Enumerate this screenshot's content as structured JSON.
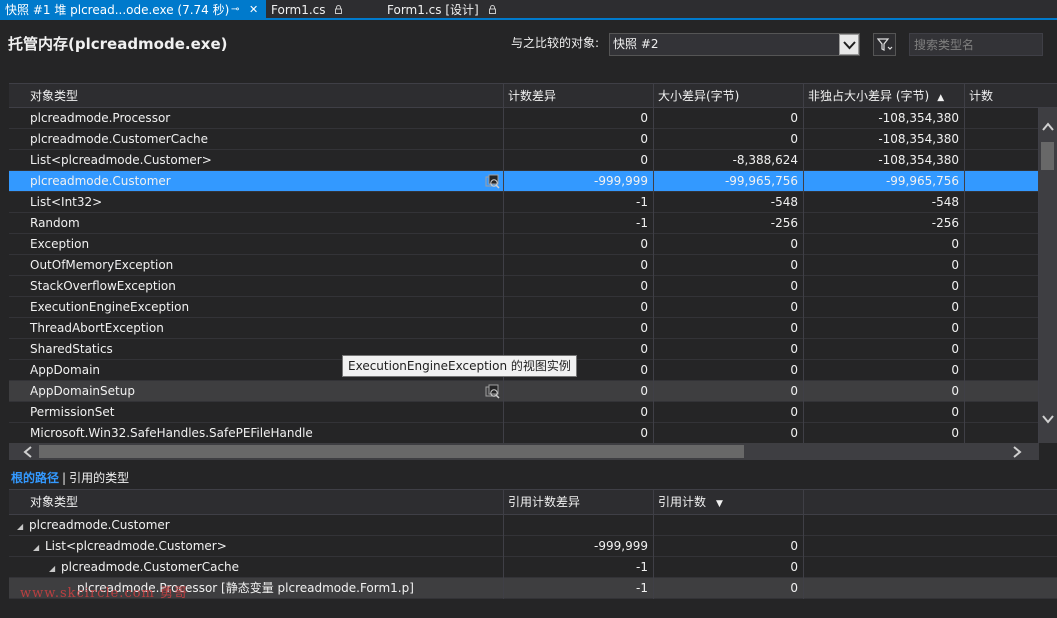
{
  "tabs": [
    {
      "label": "快照 #1 堆 plcread...ode.exe (7.74 秒)",
      "active": true,
      "pin": "⊸",
      "close": "✕"
    },
    {
      "label": "Form1.cs",
      "active": false,
      "lock": "🔒"
    },
    {
      "label": "Form1.cs [设计]",
      "active": false,
      "lock": "🔒"
    }
  ],
  "header": {
    "title": "托管内存(plcreadmode.exe)",
    "compare_label": "与之比较的对象:",
    "compare_value": "快照 #2",
    "search_placeholder": "搜索类型名"
  },
  "grid": {
    "columns": [
      "对象类型",
      "计数差异",
      "大小差异(字节)",
      "非独占大小差异 (字节)",
      "计数"
    ],
    "sorted_column_index": 3,
    "sort_direction": "ascending",
    "rows": [
      {
        "name": "plcreadmode.Processor",
        "count_diff": "0",
        "size_diff": "0",
        "incl_size_diff": "-108,354,380",
        "count": ""
      },
      {
        "name": "plcreadmode.CustomerCache",
        "count_diff": "0",
        "size_diff": "0",
        "incl_size_diff": "-108,354,380",
        "count": ""
      },
      {
        "name": "List<plcreadmode.Customer>",
        "count_diff": "0",
        "size_diff": "-8,388,624",
        "incl_size_diff": "-108,354,380",
        "count": ""
      },
      {
        "name": "plcreadmode.Customer",
        "count_diff": "-999,999",
        "size_diff": "-99,965,756",
        "incl_size_diff": "-99,965,756",
        "count": "",
        "selected": true,
        "icon": "instances-icon"
      },
      {
        "name": "List<Int32>",
        "count_diff": "-1",
        "size_diff": "-548",
        "incl_size_diff": "-548",
        "count": ""
      },
      {
        "name": "Random",
        "count_diff": "-1",
        "size_diff": "-256",
        "incl_size_diff": "-256",
        "count": ""
      },
      {
        "name": "Exception",
        "count_diff": "0",
        "size_diff": "0",
        "incl_size_diff": "0",
        "count": ""
      },
      {
        "name": "OutOfMemoryException",
        "count_diff": "0",
        "size_diff": "0",
        "incl_size_diff": "0",
        "count": ""
      },
      {
        "name": "StackOverflowException",
        "count_diff": "0",
        "size_diff": "0",
        "incl_size_diff": "0",
        "count": ""
      },
      {
        "name": "ExecutionEngineException",
        "count_diff": "0",
        "size_diff": "0",
        "incl_size_diff": "0",
        "count": ""
      },
      {
        "name": "ThreadAbortException",
        "count_diff": "0",
        "size_diff": "0",
        "incl_size_diff": "0",
        "count": ""
      },
      {
        "name": "SharedStatics",
        "count_diff": "0",
        "size_diff": "0",
        "incl_size_diff": "0",
        "count": ""
      },
      {
        "name": "AppDomain",
        "count_diff": "0",
        "size_diff": "0",
        "incl_size_diff": "0",
        "count": ""
      },
      {
        "name": "AppDomainSetup",
        "count_diff": "0",
        "size_diff": "0",
        "incl_size_diff": "0",
        "count": "",
        "hover": true,
        "icon": "instances-icon"
      },
      {
        "name": "PermissionSet",
        "count_diff": "0",
        "size_diff": "0",
        "incl_size_diff": "0",
        "count": ""
      },
      {
        "name": "Microsoft.Win32.SafeHandles.SafePEFileHandle",
        "count_diff": "0",
        "size_diff": "0",
        "incl_size_diff": "0",
        "count": ""
      }
    ]
  },
  "tooltip": "ExecutionEngineException 的视图实例",
  "bottom": {
    "tab_active": "根的路径",
    "separator": "|",
    "tab_inactive": "引用的类型",
    "columns": [
      "对象类型",
      "引用计数差异",
      "引用计数"
    ],
    "sort_indicator": "▼",
    "rows": [
      {
        "indent": 0,
        "expander": "◢",
        "name": "plcreadmode.Customer",
        "ref_count_diff": "",
        "ref_count": ""
      },
      {
        "indent": 1,
        "expander": "◢",
        "name": "List<plcreadmode.Customer>",
        "ref_count_diff": "-999,999",
        "ref_count": "0"
      },
      {
        "indent": 2,
        "expander": "◢",
        "name": "plcreadmode.CustomerCache",
        "ref_count_diff": "-1",
        "ref_count": "0"
      },
      {
        "indent": 3,
        "expander": "",
        "name": "plcreadmode.Processor [静态变量 plcreadmode.Form1.p]",
        "ref_count_diff": "-1",
        "ref_count": "0",
        "hover": true
      }
    ]
  },
  "watermark": "www.skcircle.com 勇哥",
  "colors": {
    "accent": "#007acc",
    "selection": "#3399ff",
    "background": "#252526"
  }
}
